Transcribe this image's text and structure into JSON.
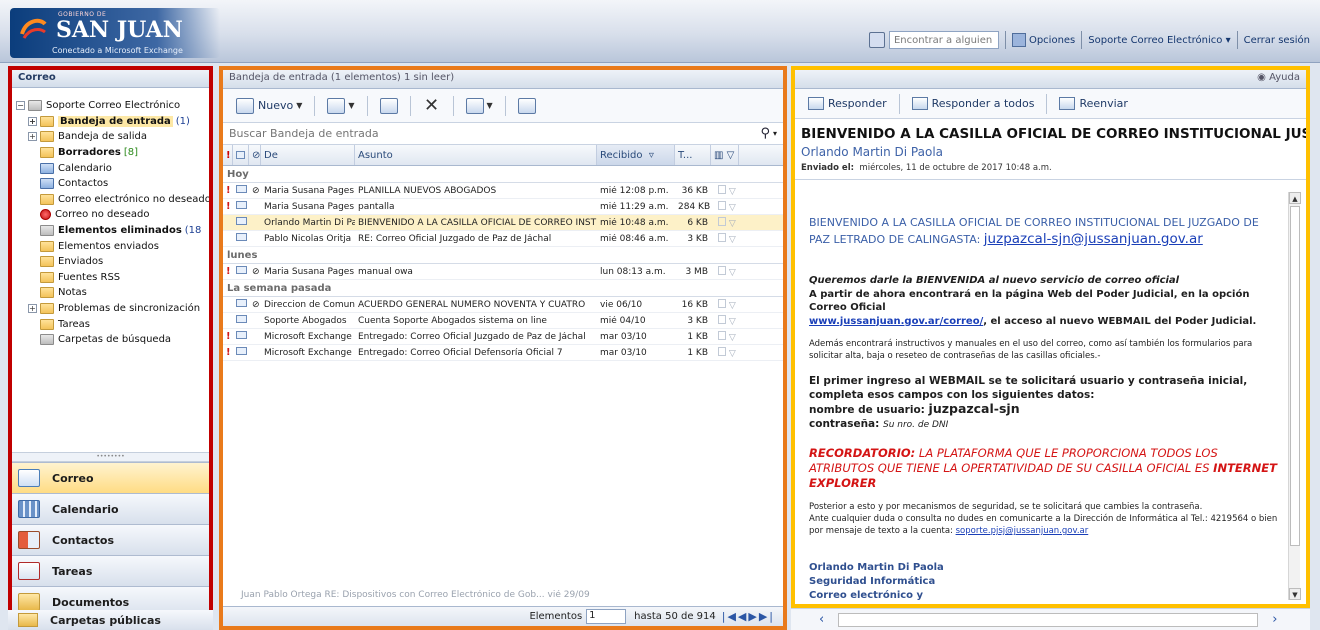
{
  "header": {
    "logo_small": "GOBIERNO DE",
    "logo_big": "SAN JUAN",
    "logo_sub": "Conectado a Microsoft Exchange",
    "find_placeholder": "Encontrar a alguien",
    "options": "Opciones",
    "account": "Soporte Correo Electrónico",
    "logout": "Cerrar sesión"
  },
  "nav": {
    "title": "Correo",
    "tree": [
      {
        "label": "Soporte Correo Electrónico",
        "icon": "mailbox-icon",
        "level": 0,
        "expander": "−",
        "bold": false,
        "count": ""
      },
      {
        "label": "Bandeja de entrada",
        "icon": "inbox-folder-icon",
        "level": 1,
        "expander": "+",
        "bold": true,
        "count": "(1)",
        "selected": true
      },
      {
        "label": "Bandeja de salida",
        "icon": "outbox-folder-icon",
        "level": 1,
        "expander": "+",
        "bold": false,
        "count": ""
      },
      {
        "label": "Borradores",
        "icon": "drafts-icon",
        "level": 1,
        "expander": "",
        "bold": true,
        "count": "[8]",
        "count_color": "green"
      },
      {
        "label": "Calendario",
        "icon": "calendar-icon",
        "level": 1,
        "expander": "",
        "bold": false,
        "count": ""
      },
      {
        "label": "Contactos",
        "icon": "contacts-icon",
        "level": 1,
        "expander": "",
        "bold": false,
        "count": ""
      },
      {
        "label": "Correo electrónico no deseado",
        "icon": "folder-icon",
        "level": 1,
        "expander": "",
        "bold": false,
        "count": ""
      },
      {
        "label": "Correo no deseado",
        "icon": "junk-icon",
        "level": 1,
        "expander": "",
        "bold": false,
        "count": ""
      },
      {
        "label": "Elementos eliminados",
        "icon": "trash-icon",
        "level": 1,
        "expander": "",
        "bold": true,
        "count": "(18"
      },
      {
        "label": "Elementos enviados",
        "icon": "sent-folder-icon",
        "level": 1,
        "expander": "",
        "bold": false,
        "count": ""
      },
      {
        "label": "Enviados",
        "icon": "folder-icon",
        "level": 1,
        "expander": "",
        "bold": false,
        "count": ""
      },
      {
        "label": "Fuentes RSS",
        "icon": "folder-icon",
        "level": 1,
        "expander": "",
        "bold": false,
        "count": ""
      },
      {
        "label": "Notas",
        "icon": "notes-icon",
        "level": 1,
        "expander": "",
        "bold": false,
        "count": ""
      },
      {
        "label": "Problemas de sincronización",
        "icon": "folder-icon",
        "level": 1,
        "expander": "+",
        "bold": false,
        "count": ""
      },
      {
        "label": "Tareas",
        "icon": "tasks-icon",
        "level": 1,
        "expander": "",
        "bold": false,
        "count": ""
      },
      {
        "label": "Carpetas de búsqueda",
        "icon": "search-folder-icon",
        "level": 1,
        "expander": "",
        "bold": false,
        "count": ""
      }
    ],
    "buttons": [
      {
        "label": "Correo",
        "icon": "mail-icon",
        "cls": "env",
        "active": true
      },
      {
        "label": "Calendario",
        "icon": "calendar-icon",
        "cls": "cal",
        "active": false
      },
      {
        "label": "Contactos",
        "icon": "contacts-icon",
        "cls": "con",
        "active": false
      },
      {
        "label": "Tareas",
        "icon": "tasks-icon",
        "cls": "tsk",
        "active": false
      },
      {
        "label": "Documentos",
        "icon": "documents-icon",
        "cls": "doc",
        "active": false
      }
    ],
    "public_folders": "Carpetas públicas"
  },
  "list": {
    "title": "Bandeja de entrada (1 elementos) 1 sin leer)",
    "toolbar": {
      "new": "Nuevo"
    },
    "search_placeholder": "Buscar Bandeja de entrada",
    "columns": {
      "importance": "!",
      "from": "De",
      "subject": "Asunto",
      "received": "Recibido",
      "size": "T..."
    },
    "groups": [
      {
        "label": "Hoy",
        "rows": [
          {
            "imp": "!",
            "att": true,
            "from": "Maria Susana Pages",
            "subject": "PLANILLA NUEVOS ABOGADOS",
            "received": "mié 12:08 p.m.",
            "size": "36 KB",
            "selected": false
          },
          {
            "imp": "!",
            "att": false,
            "from": "Maria Susana Pages",
            "subject": "pantalla",
            "received": "mié 11:29 a.m.",
            "size": "284 KB",
            "selected": false
          },
          {
            "imp": "",
            "att": false,
            "from": "Orlando Martin Di Paola",
            "subject": "BIENVENIDO A LA CASILLA OFICIAL DE CORREO INSTIT...",
            "received": "mié 10:48 a.m.",
            "size": "6 KB",
            "selected": true
          },
          {
            "imp": "",
            "att": false,
            "from": "Pablo Nicolas Oritja",
            "subject": "RE: Correo Oficial Juzgado de Paz de Jáchal",
            "received": "mié 08:46 a.m.",
            "size": "3 KB",
            "selected": false
          }
        ]
      },
      {
        "label": "lunes",
        "rows": [
          {
            "imp": "!",
            "att": true,
            "from": "Maria Susana Pages",
            "subject": "manual owa",
            "received": "lun 08:13 a.m.",
            "size": "3 MB",
            "selected": false
          }
        ]
      },
      {
        "label": "La semana pasada",
        "rows": [
          {
            "imp": "",
            "att": true,
            "from": "Direccion de Comunic...",
            "subject": "ACUERDO GENERAL NÚMERO NOVENTA Y CUATRO",
            "received": "vie 06/10",
            "size": "16 KB",
            "selected": false
          },
          {
            "imp": "",
            "att": false,
            "from": "Soporte Abogados",
            "subject": "Cuenta Soporte Abogados sistema on line",
            "received": "mié 04/10",
            "size": "3 KB",
            "selected": false
          },
          {
            "imp": "!",
            "att": false,
            "from": "Microsoft Exchange",
            "subject": "Entregado: Correo Oficial Juzgado de Paz de Jáchal",
            "received": "mar 03/10",
            "size": "1 KB",
            "selected": false
          },
          {
            "imp": "!",
            "att": false,
            "from": "Microsoft Exchange",
            "subject": "Entregado: Correo Oficial Defensoría Oficial 7",
            "received": "mar 03/10",
            "size": "1 KB",
            "selected": false
          }
        ]
      }
    ],
    "ghost_row": "Juan Pablo Ortega   RE: Dispositivos con Correo Electrónico de Gob...   vié 29/09",
    "footer": {
      "items_label": "Elementos",
      "page_value": "1",
      "range": "hasta 50 de 914"
    }
  },
  "reading": {
    "help": "Ayuda",
    "reply": "Responder",
    "reply_all": "Responder a todos",
    "forward": "Reenviar",
    "subject": "BIENVENIDO A LA CASILLA OFICIAL DE CORREO INSTITUCIONAL JUSSANJUAN",
    "sender": "Orlando Martin Di Paola",
    "sent_label": "Enviado el:",
    "sent_value": "miércoles, 11 de octubre de 2017 10:48 a.m.",
    "body": {
      "h1": "BIENVENIDO A LA CASILLA OFICIAL DE CORREO INSTITUCIONAL DEL JUZGADO DE PAZ LETRADO DE CALINGASTA:",
      "h1_email": "juzpazcal-sjn@jussanjuan.gov.ar",
      "intro_italic": "Queremos darle  la  BIENVENIDA al nuevo servicio de correo oficial",
      "intro_text": "A partir de ahora encontrará en la página Web del Poder Judicial, en la opción Correo Oficial",
      "intro_link": "www.jussanjuan.gov.ar/correo/",
      "intro_tail": ", el acceso al nuevo WEBMAIL del Poder Judicial.",
      "p_manuals": "Además encontrará instructivos y manuales en el uso del correo, como así también los formularios para solicitar alta, baja o reseteo de contraseñas de las casillas oficiales.-",
      "p_first": "El primer ingreso al WEBMAIL se te solicitará usuario y contraseña inicial, completa esos campos con los siguientes datos:",
      "user_label": "nombre de usuario:",
      "user_value": "juzpazcal-sjn",
      "pass_label": "contraseña:",
      "pass_value": "Su nro. de DNI",
      "warn_label": "RECORDATORIO:",
      "warn_text": " LA PLATAFORMA QUE LE PROPORCIONA TODOS LOS ATRIBUTOS QUE TIENE LA OPERTATIVIDAD DE SU CASILLA OFICIAL ES ",
      "warn_em": "INTERNET EXPLORER",
      "p_security1": "Posterior a esto y por mecanismos de seguridad, se te solicitará que cambies la contraseña.",
      "p_security2": "Ante cualquier duda o consulta no dudes en comunicarte a la Dirección de Informática al Tel.: 4219564 o bien por mensaje de texto a la cuenta:",
      "support_email": "soporte.pjsj@jussanjuan.gov.ar",
      "sig1": "Orlando Martin Di Paola",
      "sig2": "Seguridad Informática",
      "sig3": "Correo electrónico y"
    }
  }
}
